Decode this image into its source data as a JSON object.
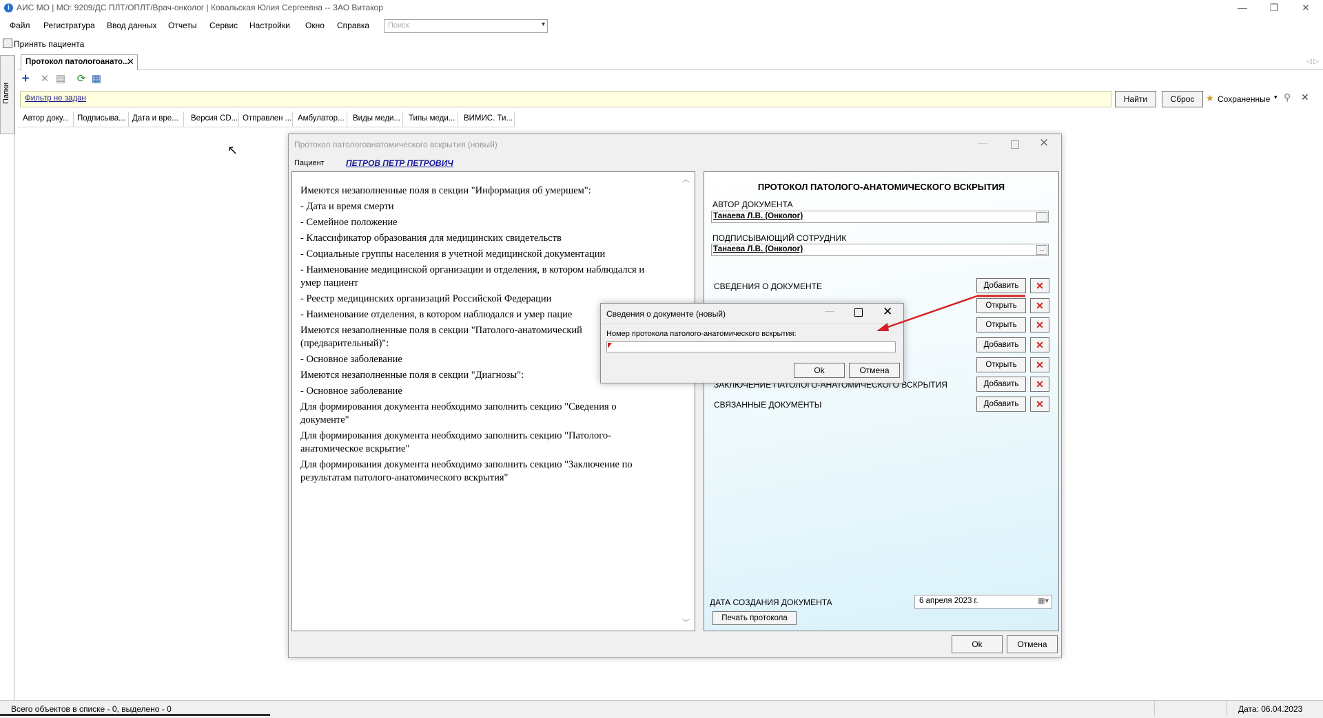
{
  "window": {
    "title": "АИС МО | МО: 9209/ДС ПЛТ/ОПЛТ/Врач-онколог | Ковальская Юлия Сергеевна -- ЗАО Витакор",
    "min": "—",
    "max": "❐",
    "close": "✕",
    "app_icon": "i"
  },
  "menu": {
    "items": [
      "Файл",
      "Регистратура",
      "Ввод данных",
      "Отчеты",
      "Сервис",
      "Настройки",
      "Окно",
      "Справка"
    ],
    "search_placeholder": "Поиск",
    "search_arrow": "▾"
  },
  "quickbar": {
    "accept_patient": "Принять пациента"
  },
  "folders": {
    "label": "Папки"
  },
  "tab": {
    "label": "Протокол патологоанато...",
    "close": "✕",
    "scroll": "◁ ▷"
  },
  "toolbar": {
    "add": "+",
    "delete": "✕",
    "properties": "▤",
    "refresh": "⟳",
    "export": "▦"
  },
  "filter": {
    "label": "Фильтр не задан",
    "find": "Найти",
    "reset": "Сброс",
    "saved": "Сохраненные",
    "saved_arrow": "▾",
    "saved_icon": "★",
    "pin": "⚲",
    "close": "✕"
  },
  "grid": {
    "columns": [
      "Автор доку...",
      "Подписыва...",
      "Дата и вре...",
      "Версия CD...",
      "Отправлен ...",
      "Амбулатор...",
      "Виды меди...",
      "Типы меди...",
      "ВИМИС. Ти..."
    ]
  },
  "status": {
    "text": "Всего объектов в списке - 0, выделено - 0",
    "date": "Дата: 06.04.2023"
  },
  "main_dialog": {
    "title": "Протокол патологоанатомического вскрытия (новый)",
    "min": "—",
    "close": "✕",
    "patient_caption": "Пациент",
    "patient_name": "ПЕТРОВ ПЕТР ПЕТРОВИЧ",
    "warnings": [
      "Имеются незаполненные поля в секции \"Информация об умершем\":",
      "- Дата и время смерти",
      "- Семейное положение",
      "- Классификатор образования для медицинских свидетельств",
      "- Социальные группы населения в учетной медицинской документации",
      "- Наименование медицинской организации и отделения, в котором наблюдался и умер пациент",
      "- Реестр медицинских организаций Российской Федерации",
      "- Наименование отделения, в котором наблюдался и умер пацие",
      "Имеются незаполненные поля в секции \"Патолого-анатомический (предварительный)\":",
      "- Основное заболевание",
      "Имеются незаполненные поля в секции \"Диагнозы\":",
      "- Основное заболевание",
      "Для формирования документа необходимо заполнить секцию \"Сведения о документе\"",
      "Для формирования документа необходимо заполнить секцию \"Патолого-анатомическое вскрытие\"",
      "Для формирования документа необходимо заполнить секцию \"Заключение по результатам патолого-анатомического вскрытия\""
    ],
    "scroll_up": "︿",
    "scroll_down": "﹀",
    "form": {
      "title": "ПРОТОКОЛ ПАТОЛОГО-АНАТОМИЧЕСКОГО ВСКРЫТИЯ",
      "author_caption": "АВТОР ДОКУМЕНТА",
      "author_value": "Танаева Л.В. (Онколог)",
      "signer_caption": "ПОДПИСЫВАЮЩИЙ СОТРУДНИК",
      "signer_value": "Танаева Л.В. (Онколог)",
      "field_btn": "...",
      "sections": [
        {
          "label": "СВЕДЕНИЯ О ДОКУМЕНТЕ",
          "button": "Добавить"
        },
        {
          "label": "",
          "button": "Открыть"
        },
        {
          "label": "",
          "button": "Открыть"
        },
        {
          "label": "",
          "button": "Добавить"
        },
        {
          "label": "",
          "button": "Открыть"
        },
        {
          "label": "ЗАКЛЮЧЕНИЕ ПАТОЛОГО-АНАТОМИЧЕСКОГО ВСКРЫТИЯ",
          "button": "Добавить"
        },
        {
          "label": "СВЯЗАННЫЕ ДОКУМЕНТЫ",
          "button": "Добавить"
        }
      ],
      "delete_glyph": "✕",
      "created_label": "ДАТА СОЗДАНИЯ ДОКУМЕНТА",
      "date_value": "6  апреля   2023 г.",
      "date_icon": "▦▾",
      "print_button": "Печать протокола"
    },
    "ok": "Ok",
    "cancel": "Отмена"
  },
  "sub_dialog": {
    "title": "Сведения о документе (новый)",
    "min": "—",
    "close": "✕",
    "field_label": "Номер протокола патолого-анатомического вскрытия:",
    "field_value": "",
    "ok": "Ok",
    "cancel": "Отмена"
  },
  "cursor": "↖",
  "colors": {
    "accent_red": "#d42020",
    "filter_bg": "#ffffe0",
    "link_blue": "#1a1a9a"
  }
}
